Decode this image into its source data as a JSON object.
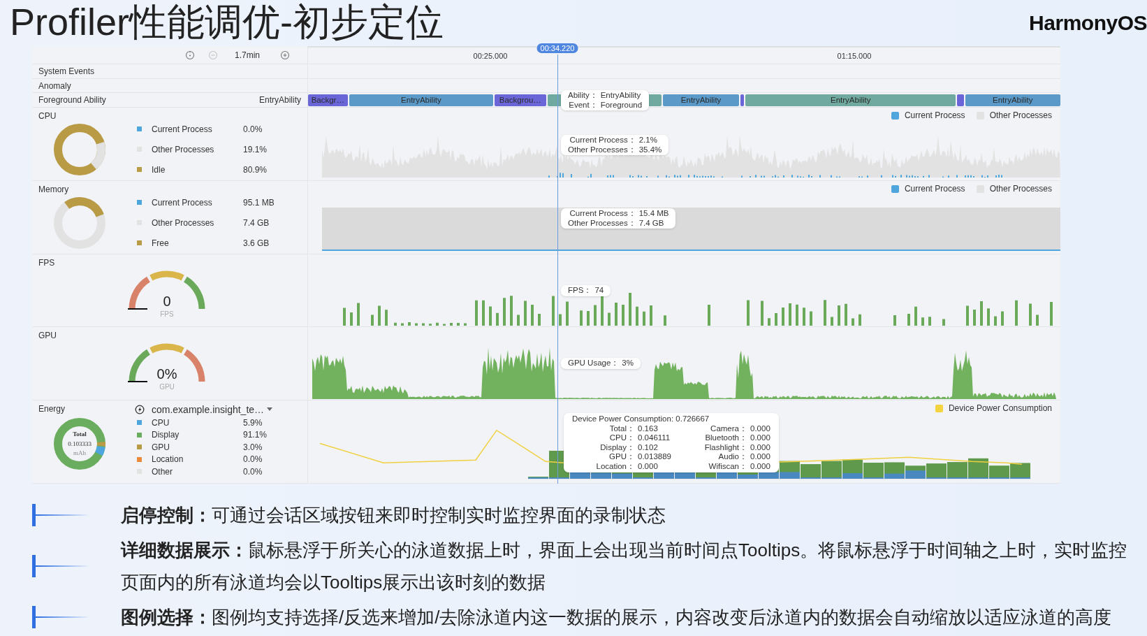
{
  "slide": {
    "title": "Profiler性能调优-初步定位",
    "brand": "HarmonyOS"
  },
  "toolbar": {
    "zoom_out": {
      "disabled": true
    },
    "span": "1.7min"
  },
  "timeline": {
    "ticks": [
      "00:25.000",
      "01:15.000"
    ],
    "cursor": "00:34.220"
  },
  "lanes": [
    {
      "kind": "simple",
      "name": "System Events"
    },
    {
      "kind": "simple",
      "name": "Anomaly"
    },
    {
      "kind": "ability",
      "name": "Foreground Ability",
      "current": "EntryAbility",
      "segments": [
        {
          "label": "Backgr…",
          "color": "#6b66d8"
        },
        {
          "label": "EntryAbility",
          "color": "#5b9ac8"
        },
        {
          "label": "Backgrou…",
          "color": "#6b66d8"
        },
        {
          "color": "#6fa99f"
        },
        {
          "label": "EntryAbility",
          "color": "#5b9ac8"
        },
        {
          "color": "#6b66d8"
        },
        {
          "label": "EntryAbility",
          "color": "#6fa99f"
        },
        {
          "color": "#6b66d8"
        },
        {
          "label": "EntryAbility",
          "color": "#5b9ac8"
        }
      ],
      "tooltip": [
        {
          "key": "Ability：",
          "value": "EntryAbility"
        },
        {
          "key": "Event：",
          "value": "Foreground"
        }
      ]
    },
    {
      "kind": "usage",
      "name": "CPU",
      "items": [
        {
          "label": "Current Process",
          "value": "0.0%",
          "color": "#4ea6dc"
        },
        {
          "label": "Other Processes",
          "value": "19.1%",
          "color": "#e2e2e2"
        },
        {
          "label": "Idle",
          "value": "80.9%",
          "color": "#b99a45"
        }
      ],
      "legend": [
        {
          "label": "Current Process",
          "color": "#4ea6dc"
        },
        {
          "label": "Other Processes",
          "color": "#e2e2e2"
        }
      ],
      "tooltip": [
        {
          "key": "Current Process：",
          "value": "2.1%"
        },
        {
          "key": "Other Processes：",
          "value": "35.4%"
        }
      ]
    },
    {
      "kind": "usage",
      "name": "Memory",
      "items": [
        {
          "label": "Current Process",
          "value": "95.1 MB",
          "color": "#4ea6dc"
        },
        {
          "label": "Other Processes",
          "value": "7.4 GB",
          "color": "#e2e2e2"
        },
        {
          "label": "Free",
          "value": "3.6 GB",
          "color": "#b99a45"
        }
      ],
      "legend": [
        {
          "label": "Current Process",
          "color": "#4ea6dc"
        },
        {
          "label": "Other Processes",
          "color": "#e2e2e2"
        }
      ],
      "tooltip": [
        {
          "key": "Current Process：",
          "value": "15.4 MB"
        },
        {
          "key": "Other Processes：",
          "value": "7.4 GB"
        }
      ]
    },
    {
      "kind": "gauge",
      "name": "FPS",
      "reading": "0",
      "unit": "FPS",
      "reversed": false,
      "tooltip": [
        {
          "key": "FPS：",
          "value": "74"
        }
      ]
    },
    {
      "kind": "gauge",
      "name": "GPU",
      "reading": "0%",
      "unit": "GPU",
      "reversed": true,
      "tooltip": [
        {
          "key": "GPU Usage：",
          "value": "3%"
        }
      ]
    },
    {
      "kind": "energy",
      "name": "Energy",
      "total_label": "Total",
      "total_value": "0.103333",
      "total_unit": "mAh",
      "app": "com.example.insight_te…",
      "items": [
        {
          "label": "CPU",
          "value": "5.9%",
          "color": "#4ea6dc"
        },
        {
          "label": "Display",
          "value": "91.1%",
          "color": "#6aad5e"
        },
        {
          "label": "GPU",
          "value": "3.0%",
          "color": "#b99a45"
        },
        {
          "label": "Location",
          "value": "0.0%",
          "color": "#ec8a3c"
        },
        {
          "label": "Other",
          "value": "0.0%",
          "color": "#e2e2e2"
        }
      ],
      "legend": [
        {
          "label": "Device Power Consumption",
          "color": "#f3d43e"
        }
      ],
      "tooltip_title": "Device Power Consumption: 0.726667",
      "tooltip": [
        {
          "key": "Total：",
          "value": "0.163"
        },
        {
          "key": "Camera：",
          "value": "0.000"
        },
        {
          "key": "CPU：",
          "value": "0.046111"
        },
        {
          "key": "Bluetooth：",
          "value": "0.000"
        },
        {
          "key": "Display：",
          "value": "0.102"
        },
        {
          "key": "Flashlight：",
          "value": "0.000"
        },
        {
          "key": "GPU：",
          "value": "0.013889"
        },
        {
          "key": "Audio：",
          "value": "0.000"
        },
        {
          "key": "Location：",
          "value": "0.000"
        },
        {
          "key": "Wifiscan：",
          "value": "0.000"
        }
      ]
    }
  ],
  "notes": [
    "**启停控制：**可通过会话区域按钮来即时控制实时监控界面的录制状态",
    "**详细数据展示：**鼠标悬浮于所关心的泳道数据上时，界面上会出现当前时间点Tooltips。将鼠标悬浮于时间轴之上时，实时监控页面内的所有泳道均会以Tooltips展示出该时刻的数据",
    "**图例选择：**图例均支持选择/反选来增加/去除泳道内这一数据的展示，内容改变后泳道内的数据会自动缩放以适应泳道的高度"
  ]
}
